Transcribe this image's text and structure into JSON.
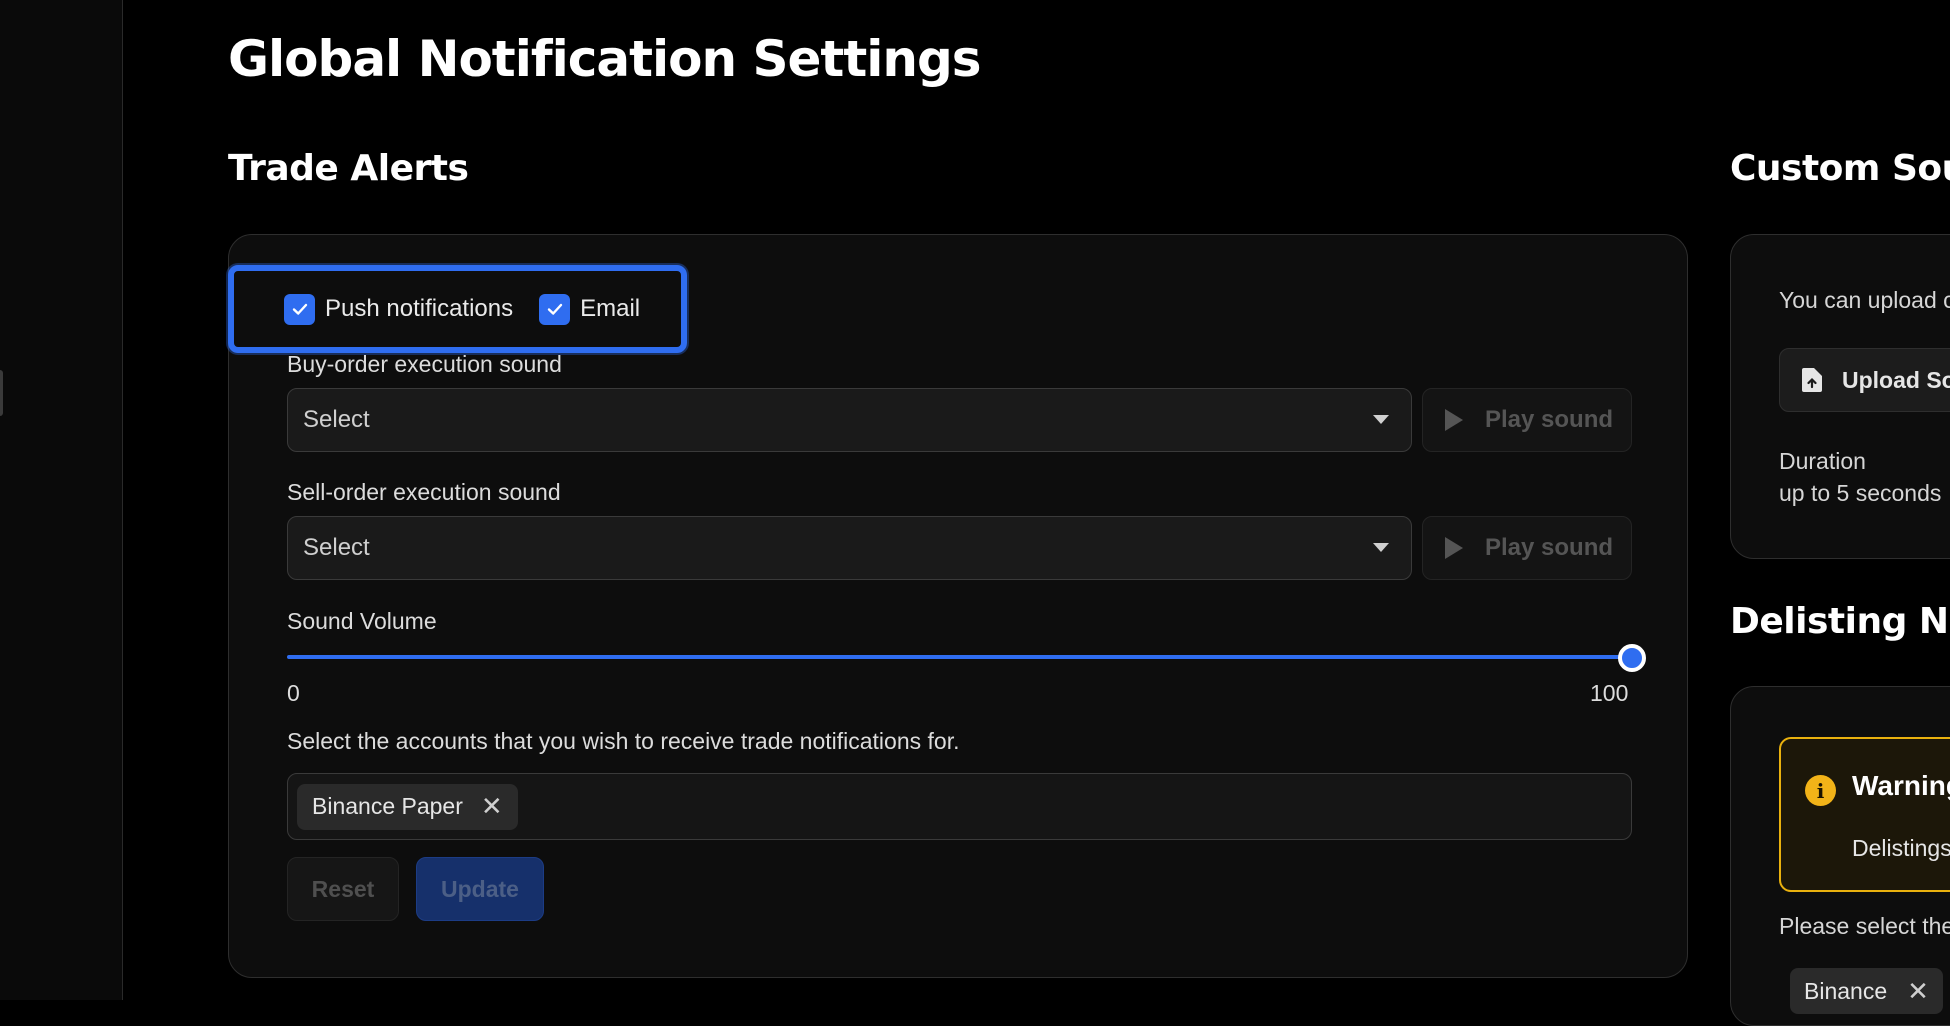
{
  "page": {
    "title": "Global Notification Settings"
  },
  "trade_alerts": {
    "title": "Trade Alerts",
    "channels": [
      {
        "label": "Push notifications",
        "checked": true
      },
      {
        "label": "Email",
        "checked": true
      }
    ],
    "buy_sound": {
      "label": "Buy-order execution sound",
      "value": "Select",
      "play_label": "Play sound"
    },
    "sell_sound": {
      "label": "Sell-order execution sound",
      "value": "Select",
      "play_label": "Play sound"
    },
    "volume": {
      "label": "Sound Volume",
      "min": "0",
      "max": "100",
      "value": 100
    },
    "accounts": {
      "label": "Select the accounts that you wish to receive trade notifications for.",
      "selected": [
        "Binance Paper"
      ]
    },
    "reset_label": "Reset",
    "update_label": "Update"
  },
  "custom_sounds": {
    "title": "Custom Soun",
    "intro": "You can upload c",
    "upload_label": "Upload So",
    "duration_label": "Duration",
    "duration_value": "up to 5 seconds"
  },
  "delisting": {
    "title": "Delisting Noti",
    "warning_title": "Warning",
    "warning_text": "Delistings",
    "select_label": "Please select the",
    "selected_tag": "Binance"
  },
  "colors": {
    "accent": "#2f6df0",
    "warning": "#e9b10e",
    "background": "#000000"
  }
}
